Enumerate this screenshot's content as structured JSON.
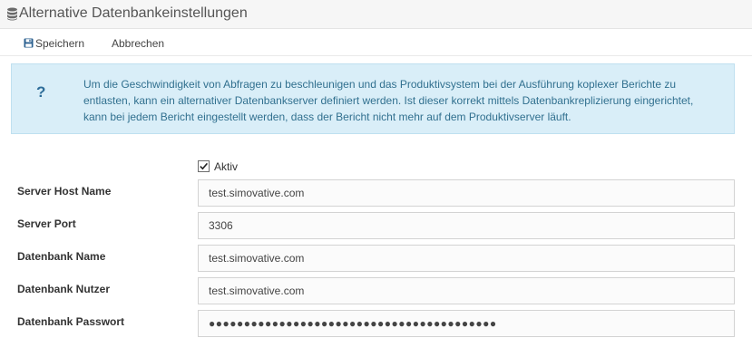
{
  "window": {
    "title": "Alternative Datenbankeinstellungen",
    "icon": "database-icon"
  },
  "toolbar": {
    "save_label": "Speichern",
    "save_icon": "floppy-disk-icon",
    "cancel_label": "Abbrechen"
  },
  "info": {
    "icon": "question-mark-icon",
    "text": "Um die Geschwindigkeit von Abfragen zu beschleunigen und das Produktivsystem bei der Ausführung koplexer Berichte zu entlasten, kann ein alternativer Datenbankserver definiert werden. Ist dieser korrekt mittels Datenbankreplizierung eingerichtet, kann bei jedem Bericht eingestellt werden, dass der Bericht nicht mehr auf dem Produktivserver läuft."
  },
  "form": {
    "active": {
      "label": "Aktiv",
      "checked": true
    },
    "fields": [
      {
        "label": "Server Host Name",
        "value": "test.simovative.com"
      },
      {
        "label": "Server Port",
        "value": "3306"
      },
      {
        "label": "Datenbank Name",
        "value": "test.simovative.com"
      },
      {
        "label": "Datenbank Nutzer",
        "value": "test.simovative.com"
      },
      {
        "label": "Datenbank Passwort",
        "value": "●●●●●●●●●●●●●●●●●●●●●●●●●●●●●●●●●●●●●●●●●"
      }
    ]
  },
  "colors": {
    "info_background": "#d9eef8",
    "info_text": "#31708f",
    "title_bar": "#f6f6f6"
  }
}
